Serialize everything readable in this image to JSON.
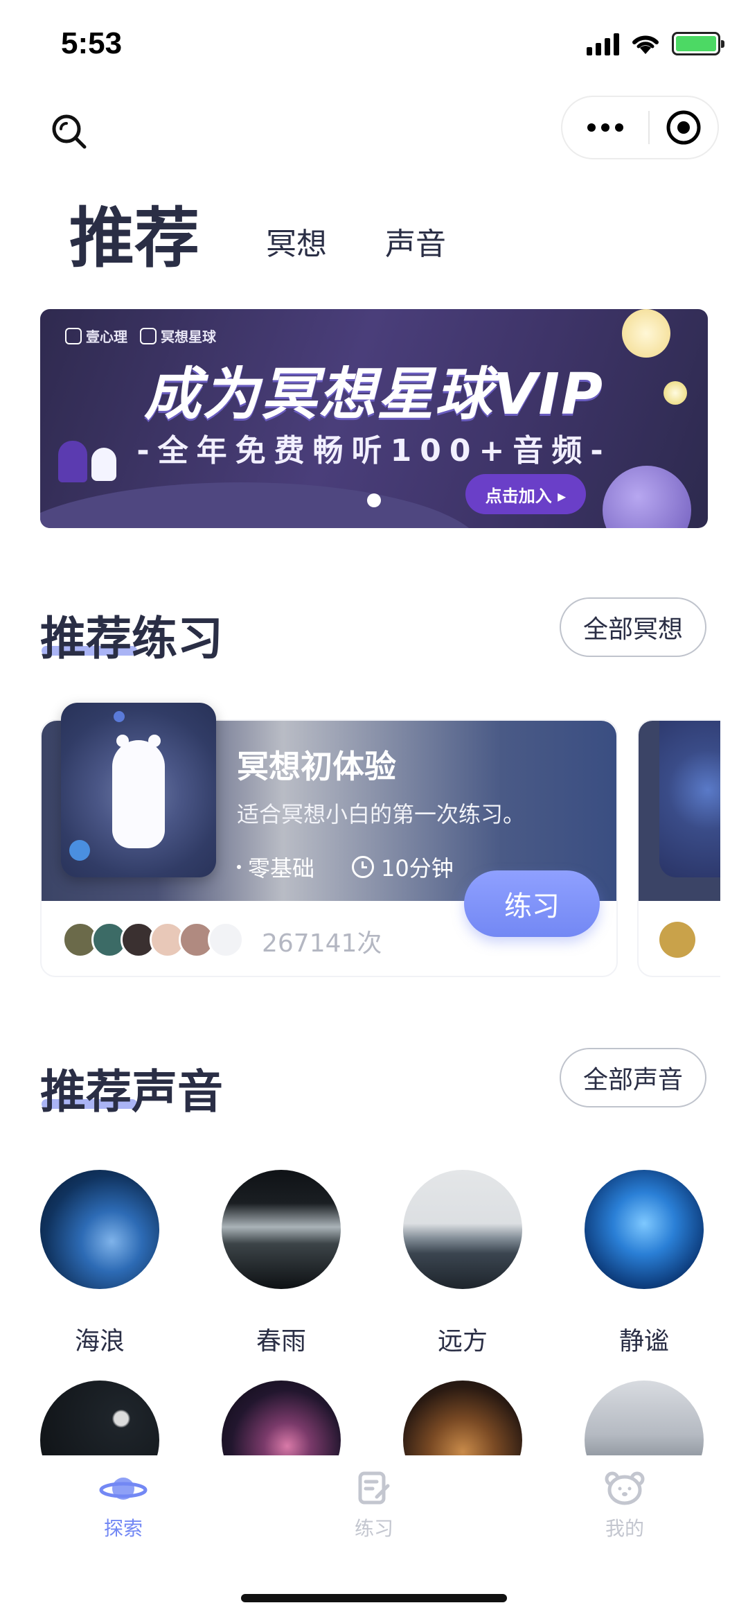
{
  "status_bar": {
    "time": "5:53"
  },
  "tabs": {
    "active": "推荐",
    "items": [
      "冥想",
      "声音"
    ]
  },
  "banner": {
    "brand_1": "壹心理",
    "brand_2": "冥想星球",
    "title": "成为冥想星球VIP",
    "subtitle": "-全年免费畅听100+音频-",
    "cta": "点击加入 ▸"
  },
  "practice_section": {
    "title": "推荐练习",
    "all_button": "全部冥想",
    "card": {
      "title": "冥想初体验",
      "description": "适合冥想小白的第一次练习。",
      "level": "零基础",
      "duration": "10分钟",
      "action": "练习",
      "play_count": "267141次"
    }
  },
  "sound_section": {
    "title": "推荐声音",
    "all_button": "全部声音",
    "items": [
      {
        "label": "海浪"
      },
      {
        "label": "春雨"
      },
      {
        "label": "远方"
      },
      {
        "label": "静谧"
      }
    ]
  },
  "tabbar": {
    "items": [
      {
        "label": "探索",
        "icon": "planet-icon",
        "active": true
      },
      {
        "label": "练习",
        "icon": "notebook-edit-icon",
        "active": false
      },
      {
        "label": "我的",
        "icon": "bear-face-icon",
        "active": false
      }
    ]
  },
  "colors": {
    "accent": "#7388f4",
    "heading": "#2a2e45",
    "inactive": "#c3c6cf"
  }
}
